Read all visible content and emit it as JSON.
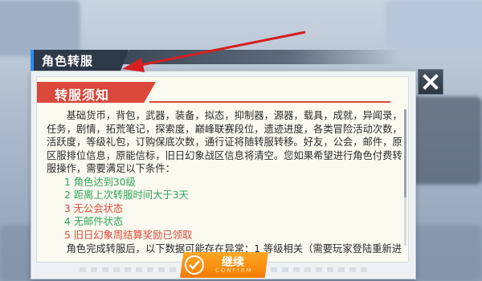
{
  "header": {
    "title": "角色转服"
  },
  "notice": {
    "subtitle": "转服须知",
    "paragraph": "基础货币，背包，武器，装备，拟态，抑制器，源器，载具，成就，异闻录，任务，剧情，拓荒笔记，探索度，巅峰联赛段位，遗迹进度，各类冒险活动次数，活跃度，等级礼包，订购保底次数，通行证将随转服转移。好友，公会，邮件，原区服排位信息，原能信标，旧日幻象战区信息将清空。您如果希望进行角色付费转服操作，需要满足以下条件：",
    "conditions": [
      {
        "text": "1 角色达到30级",
        "color": "green"
      },
      {
        "text": "2 距离上次转服时间大于3天",
        "color": "green"
      },
      {
        "text": "3 无公会状态",
        "color": "red"
      },
      {
        "text": "4 无邮件状态",
        "color": "green"
      },
      {
        "text": "5 旧日幻象周结算奖励已领取",
        "color": "red"
      }
    ],
    "after_text": "角色完成转服后，以下数据可能存在异常：1 等级相关（需要玩家登陆重新进"
  },
  "buttons": {
    "continue_label": "继续",
    "continue_sub": "CONFIRM",
    "close_icon": "close-x-icon"
  },
  "colors": {
    "accent_red": "#d9483a",
    "accent_orange": "#f57c00",
    "condition_green": "#2fa35a",
    "header_blue": "#2d8cf0"
  }
}
